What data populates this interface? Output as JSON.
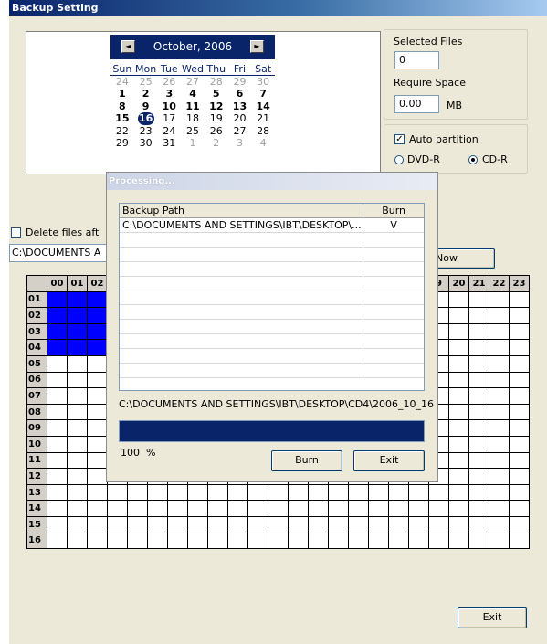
{
  "window": {
    "title": "Backup Setting"
  },
  "calendar": {
    "month_label": "October, 2006",
    "prev_symbol": "◄",
    "next_symbol": "►",
    "weekdays": [
      "Sun",
      "Mon",
      "Tue",
      "Wed",
      "Thu",
      "Fri",
      "Sat"
    ],
    "weeks": [
      [
        {
          "d": "24",
          "t": "other"
        },
        {
          "d": "25",
          "t": "other"
        },
        {
          "d": "26",
          "t": "other"
        },
        {
          "d": "27",
          "t": "other"
        },
        {
          "d": "28",
          "t": "other"
        },
        {
          "d": "29",
          "t": "other"
        },
        {
          "d": "30",
          "t": "other"
        }
      ],
      [
        {
          "d": "1",
          "t": "bold"
        },
        {
          "d": "2",
          "t": "bold"
        },
        {
          "d": "3",
          "t": "bold"
        },
        {
          "d": "4",
          "t": "bold"
        },
        {
          "d": "5",
          "t": "bold"
        },
        {
          "d": "6",
          "t": "bold"
        },
        {
          "d": "7",
          "t": "bold"
        }
      ],
      [
        {
          "d": "8",
          "t": "bold"
        },
        {
          "d": "9",
          "t": "bold"
        },
        {
          "d": "10",
          "t": "bold"
        },
        {
          "d": "11",
          "t": "bold"
        },
        {
          "d": "12",
          "t": "bold"
        },
        {
          "d": "13",
          "t": "bold"
        },
        {
          "d": "14",
          "t": "bold"
        }
      ],
      [
        {
          "d": "15",
          "t": "bold"
        },
        {
          "d": "16",
          "t": "selected"
        },
        {
          "d": "17",
          "t": "normal"
        },
        {
          "d": "18",
          "t": "normal"
        },
        {
          "d": "19",
          "t": "normal"
        },
        {
          "d": "20",
          "t": "normal"
        },
        {
          "d": "21",
          "t": "normal"
        }
      ],
      [
        {
          "d": "22",
          "t": "normal"
        },
        {
          "d": "23",
          "t": "normal"
        },
        {
          "d": "24",
          "t": "normal"
        },
        {
          "d": "25",
          "t": "normal"
        },
        {
          "d": "26",
          "t": "normal"
        },
        {
          "d": "27",
          "t": "normal"
        },
        {
          "d": "28",
          "t": "normal"
        }
      ],
      [
        {
          "d": "29",
          "t": "normal"
        },
        {
          "d": "30",
          "t": "normal"
        },
        {
          "d": "31",
          "t": "normal"
        },
        {
          "d": "1",
          "t": "other"
        },
        {
          "d": "2",
          "t": "other"
        },
        {
          "d": "3",
          "t": "other"
        },
        {
          "d": "4",
          "t": "other"
        }
      ]
    ]
  },
  "files": {
    "selected_label": "Selected Files",
    "selected_value": "0",
    "space_label": "Require Space",
    "space_value": "0.00",
    "space_unit": "MB"
  },
  "options": {
    "auto_partition_label": "Auto partition",
    "auto_partition_checked": true,
    "dvd_label": "DVD-R",
    "cd_label": "CD-R",
    "selected_media": "CD-R"
  },
  "delete_files_label": "Delete files aft",
  "path_value": "C:\\DOCUMENTS A",
  "now_button": "Now",
  "exit_button": "Exit",
  "schedule": {
    "columns_left": [
      "00",
      "01",
      "02"
    ],
    "columns_right": [
      "9",
      "20",
      "21",
      "22",
      "23"
    ],
    "rows": [
      "01",
      "02",
      "03",
      "04",
      "05",
      "06",
      "07",
      "08",
      "09",
      "10",
      "11",
      "12",
      "13",
      "14",
      "15",
      "16"
    ],
    "selected_rows": [
      "01",
      "02",
      "03",
      "04"
    ],
    "selected_columns": [
      "00",
      "01",
      "02"
    ],
    "colors": {
      "selected": "#0000ff",
      "header": "#d4d0c8"
    }
  },
  "processing": {
    "title": "Processing...",
    "col_path": "Backup Path",
    "col_burn": "Burn",
    "rows": [
      {
        "path": "C:\\DOCUMENTS AND SETTINGS\\IBT\\DESKTOP\\...",
        "burn": "V"
      }
    ],
    "current_file": "C:\\DOCUMENTS AND SETTINGS\\IBT\\DESKTOP\\CD4\\2006_10_16",
    "progress_percent": 100,
    "progress_label": "100  %",
    "burn_button": "Burn",
    "exit_button": "Exit",
    "colors": {
      "progress": "#0a246a"
    }
  }
}
